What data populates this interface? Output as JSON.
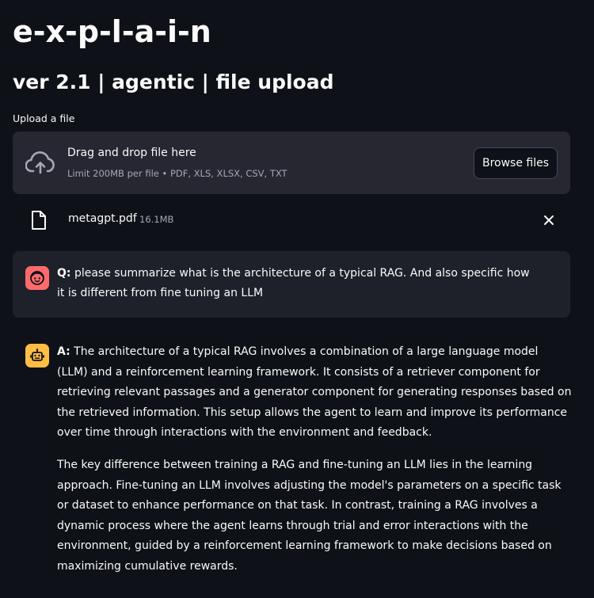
{
  "header": {
    "title": "e-x-p-l-a-i-n",
    "subtitle": "ver 2.1 | agentic | file upload"
  },
  "uploader": {
    "label": "Upload a file",
    "drop_title": "Drag and drop file here",
    "drop_hint": "Limit 200MB per file • PDF, XLS, XLSX, CSV, TXT",
    "browse_label": "Browse files",
    "icon": "cloud-upload-icon"
  },
  "file": {
    "name": "metagpt.pdf",
    "size": "16.1MB",
    "icon": "file-icon",
    "remove_icon": "close-icon"
  },
  "chat": {
    "question": {
      "prefix": "Q:",
      "text": "please summarize what is the architecture of a typical RAG. And also specific how it is different from fine tuning an LLM",
      "avatar_color": "#ff6b6b"
    },
    "answer": {
      "prefix": "A:",
      "paragraph1": "The architecture of a typical RAG involves a combination of a large language model (LLM) and a reinforcement learning framework. It consists of a retriever component for retrieving relevant passages and a generator component for generating responses based on the retrieved information. This setup allows the agent to learn and improve its performance over time through interactions with the environment and feedback.",
      "paragraph2": "The key difference between training a RAG and fine-tuning an LLM lies in the learning approach. Fine-tuning an LLM involves adjusting the model's parameters on a specific task or dataset to enhance performance on that task. In contrast, training a RAG involves a dynamic process where the agent learns through trial and error interactions with the environment, guided by a reinforcement learning framework to make decisions based on maximizing cumulative rewards.",
      "avatar_color": "#ffbd45"
    }
  },
  "colors": {
    "background": "#0e1117",
    "surface": "#262730",
    "chat_surface": "#1e2129",
    "text": "#fafafa",
    "muted": "#a3a8b8"
  }
}
